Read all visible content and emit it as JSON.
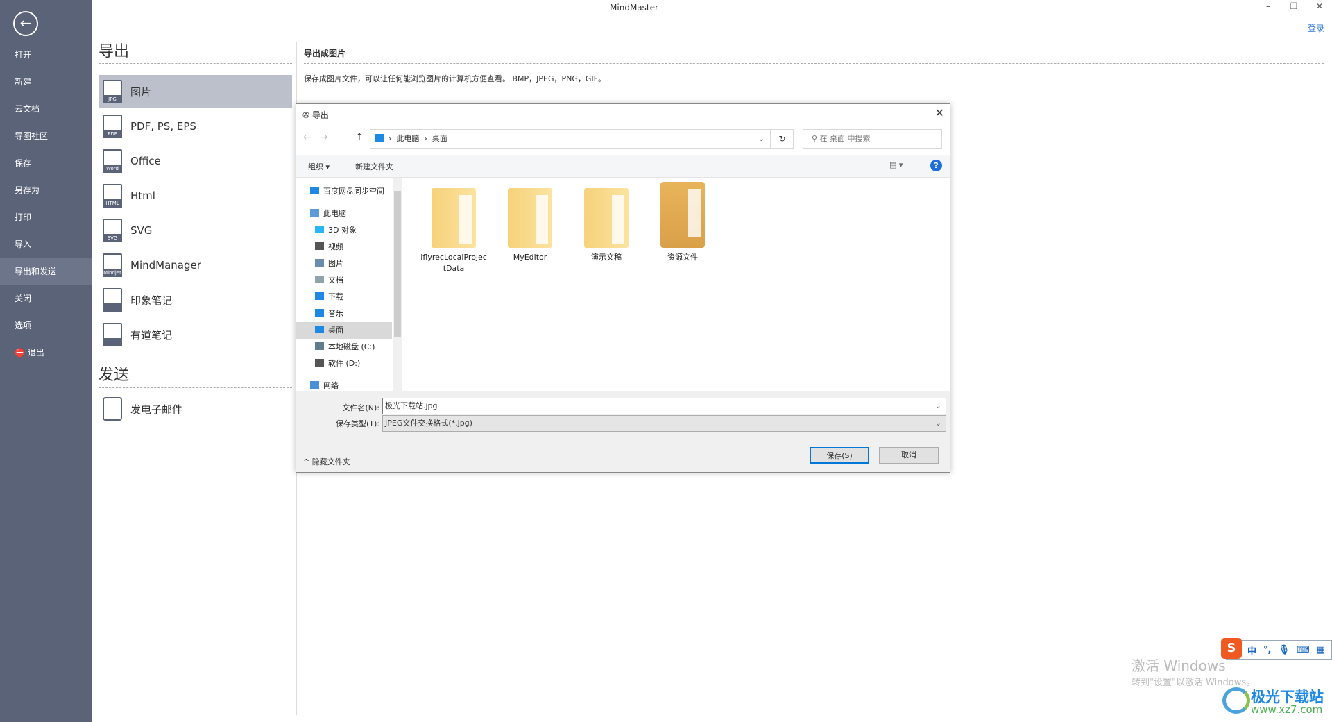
{
  "app": {
    "title": "MindMaster",
    "login": "登录"
  },
  "sidebar": {
    "items": [
      "打开",
      "新建",
      "云文档",
      "导图社区",
      "保存",
      "另存为",
      "打印",
      "导入",
      "导出和发送",
      "关闭",
      "选项",
      "退出"
    ],
    "active": "导出和发送"
  },
  "export": {
    "heading": "导出",
    "items": [
      {
        "label": "图片",
        "badge": "JPG"
      },
      {
        "label": "PDF, PS, EPS",
        "badge": "PDF"
      },
      {
        "label": "Office",
        "badge": "Word"
      },
      {
        "label": "Html",
        "badge": "HTML"
      },
      {
        "label": "SVG",
        "badge": "SVG"
      },
      {
        "label": "MindManager",
        "badge": "Mindjet"
      },
      {
        "label": "印象笔记",
        "badge": ""
      },
      {
        "label": "有道笔记",
        "badge": ""
      }
    ],
    "send_heading": "发送",
    "send_items": [
      "发电子邮件"
    ]
  },
  "detail": {
    "title": "导出成图片",
    "desc": "保存成图片文件，可以让任何能浏览图片的计算机方便查看。 BMP，JPEG，PNG，GIF。"
  },
  "dialog": {
    "title": "导出",
    "breadcrumb": [
      "此电脑",
      "桌面"
    ],
    "search_placeholder": "在 桌面 中搜索",
    "organize": "组织 ▾",
    "new_folder": "新建文件夹",
    "nav": [
      "百度网盘同步空间",
      "此电脑",
      "3D 对象",
      "视频",
      "图片",
      "文档",
      "下载",
      "音乐",
      "桌面",
      "本地磁盘 (C:)",
      "软件 (D:)",
      "网络"
    ],
    "nav_selected": "桌面",
    "files": [
      "IflyrecLocalProjectData",
      "MyEditor",
      "演示文稿",
      "资源文件"
    ],
    "filename_label": "文件名(N):",
    "filename": "极光下载站.jpg",
    "type_label": "保存类型(T):",
    "type": "JPEG文件交换格式(*.jpg)",
    "hide_folders": "隐藏文件夹",
    "save": "保存(S)",
    "cancel": "取消"
  },
  "watermark": {
    "line1": "激活 Windows",
    "line2": "转到\"设置\"以激活 Windows。"
  },
  "ime": {
    "mode": "中"
  },
  "logo": {
    "name": "极光下载站",
    "url": "www.xz7.com"
  }
}
